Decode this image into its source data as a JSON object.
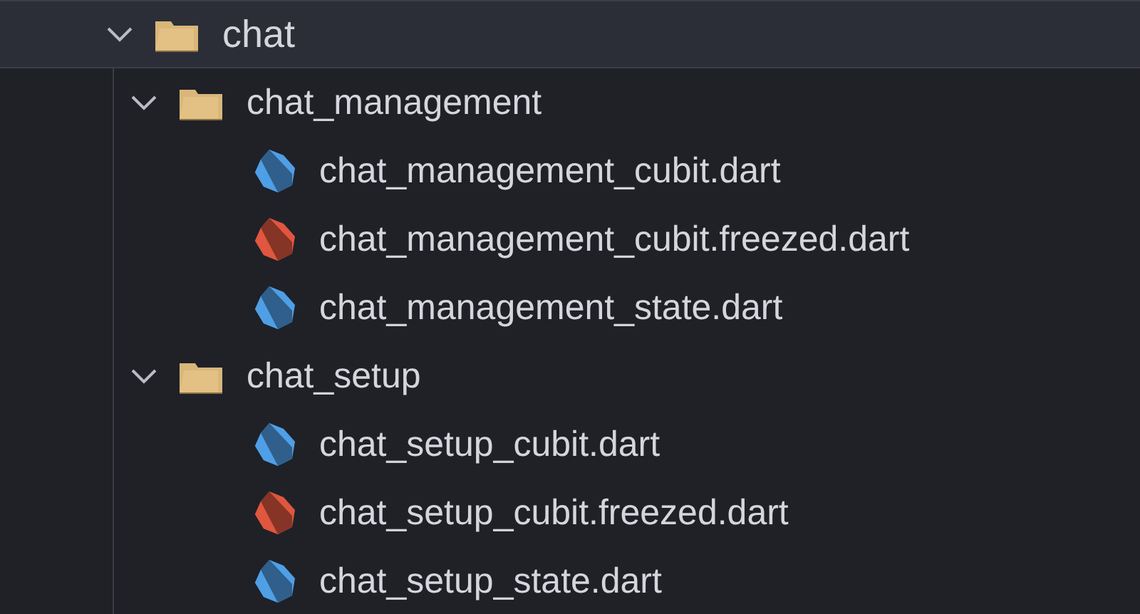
{
  "tree": [
    {
      "kind": "folder",
      "label": "chat",
      "expanded": true,
      "selected": true,
      "children": [
        {
          "kind": "folder",
          "label": "chat_management",
          "expanded": true,
          "selected": false,
          "children": [
            {
              "kind": "file",
              "label": "chat_management_cubit.dart",
              "color": "#4f9fe6",
              "selected": false
            },
            {
              "kind": "file",
              "label": "chat_management_cubit.freezed.dart",
              "color": "#e0563f",
              "selected": false
            },
            {
              "kind": "file",
              "label": "chat_management_state.dart",
              "color": "#4f9fe6",
              "selected": false
            }
          ]
        },
        {
          "kind": "folder",
          "label": "chat_setup",
          "expanded": true,
          "selected": false,
          "children": [
            {
              "kind": "file",
              "label": "chat_setup_cubit.dart",
              "color": "#4f9fe6",
              "selected": false
            },
            {
              "kind": "file",
              "label": "chat_setup_cubit.freezed.dart",
              "color": "#e0563f",
              "selected": false
            },
            {
              "kind": "file",
              "label": "chat_setup_state.dart",
              "color": "#4f9fe6",
              "selected": false
            }
          ]
        }
      ]
    }
  ]
}
